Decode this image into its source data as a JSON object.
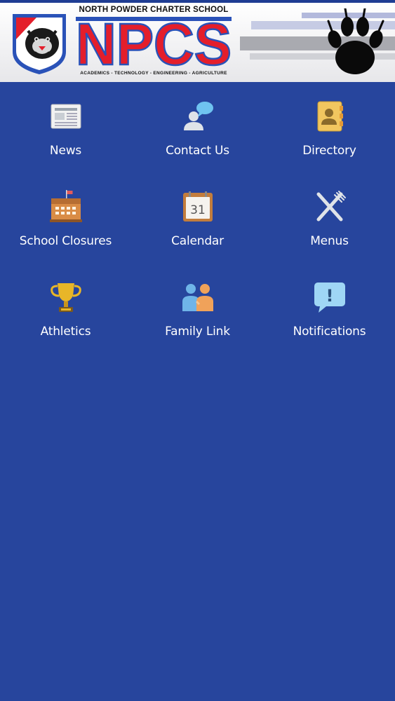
{
  "header": {
    "school_name": "NORTH POWDER CHARTER SCHOOL",
    "logo_letters": "NPCS",
    "tagline": "ACADEMICS - TECHNOLOGY - ENGINEERING - AGRICULTURE",
    "crest_icon": "panther-crest-icon",
    "paw_icon": "paw-print-icon",
    "colors": {
      "blue": "#2a52b8",
      "red": "#e41e2b",
      "background": "#27459d"
    }
  },
  "menu": {
    "items": [
      {
        "label": "News",
        "icon": "newspaper-icon"
      },
      {
        "label": "Contact Us",
        "icon": "contact-chat-icon"
      },
      {
        "label": "Directory",
        "icon": "address-book-icon"
      },
      {
        "label": "School Closures",
        "icon": "podium-icon"
      },
      {
        "label": "Calendar",
        "icon": "calendar-icon",
        "day": "31"
      },
      {
        "label": "Menus",
        "icon": "fork-knife-icon"
      },
      {
        "label": "Athletics",
        "icon": "trophy-icon"
      },
      {
        "label": "Family Link",
        "icon": "people-icon"
      },
      {
        "label": "Notifications",
        "icon": "alert-bubble-icon",
        "glyph": "!"
      }
    ]
  }
}
